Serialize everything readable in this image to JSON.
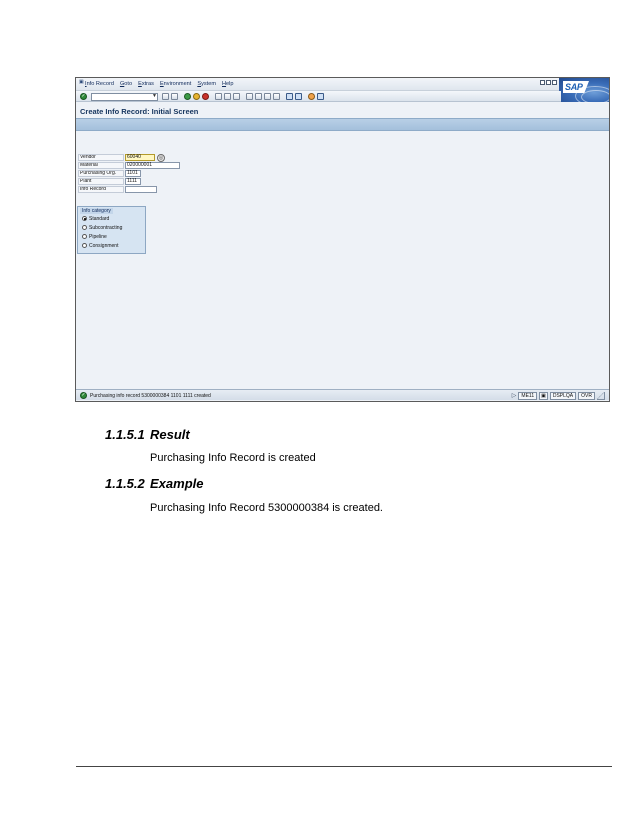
{
  "sap": {
    "menu": [
      "Info Record",
      "Goto",
      "Extras",
      "Environment",
      "System",
      "Help"
    ],
    "logo_text": "SAP",
    "page_title": "Create Info Record: Initial Screen",
    "fields": [
      {
        "label": "Vendor",
        "value": "60040"
      },
      {
        "label": "Material",
        "value": "020000001"
      },
      {
        "label": "Purchasing Org.",
        "value": "1101"
      },
      {
        "label": "Plant",
        "value": "1111"
      },
      {
        "label": "Info Record",
        "value": ""
      }
    ],
    "info_category": {
      "title": "Info category",
      "options": [
        {
          "label": "Standard",
          "selected": true
        },
        {
          "label": "Subcontracting",
          "selected": false
        },
        {
          "label": "Pipeline",
          "selected": false
        },
        {
          "label": "Consignment",
          "selected": false
        }
      ]
    },
    "status": {
      "message": "Purchasing info record 5300000384 1101 1111 created",
      "transaction": "ME11",
      "system": "DSPLQA",
      "mode": "OVR"
    }
  },
  "doc": {
    "result": {
      "number": "1.1.5.1",
      "heading": "Result",
      "text": "Purchasing Info Record is created"
    },
    "example": {
      "number": "1.1.5.2",
      "heading": "Example",
      "text": "Purchasing Info Record 5300000384 is created."
    }
  }
}
